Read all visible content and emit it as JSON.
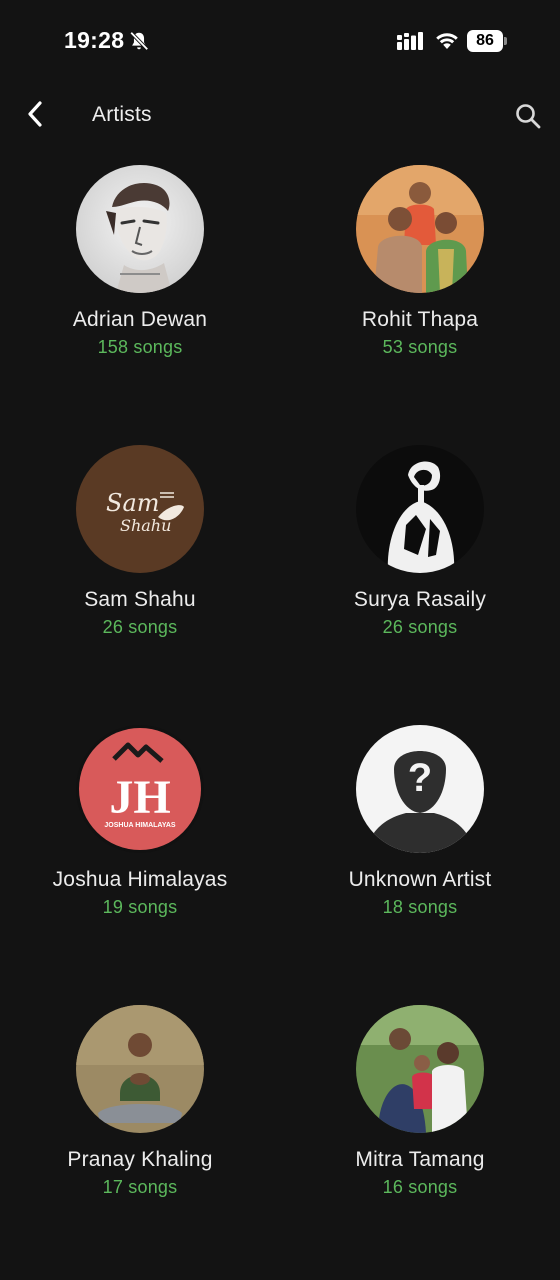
{
  "status_bar": {
    "time": "19:28",
    "battery": "86"
  },
  "header": {
    "title": "Artists"
  },
  "artists": [
    {
      "name": "Adrian Dewan",
      "songs": "158 songs"
    },
    {
      "name": "Rohit Thapa",
      "songs": "53 songs"
    },
    {
      "name": "Sam Shahu",
      "songs": "26 songs",
      "logo_text": "Sam Shahu"
    },
    {
      "name": "Surya Rasaily",
      "songs": "26 songs"
    },
    {
      "name": "Joshua Himalayas",
      "songs": "19 songs",
      "logo_text": "JH",
      "logo_subtext": "JOSHUA HIMALAYAS"
    },
    {
      "name": "Unknown Artist",
      "songs": "18 songs"
    },
    {
      "name": "Pranay Khaling",
      "songs": "17 songs"
    },
    {
      "name": "Mitra Tamang",
      "songs": "16 songs"
    }
  ],
  "colors": {
    "background": "#131313",
    "song_count": "#5cb85c",
    "text": "#ececec"
  }
}
